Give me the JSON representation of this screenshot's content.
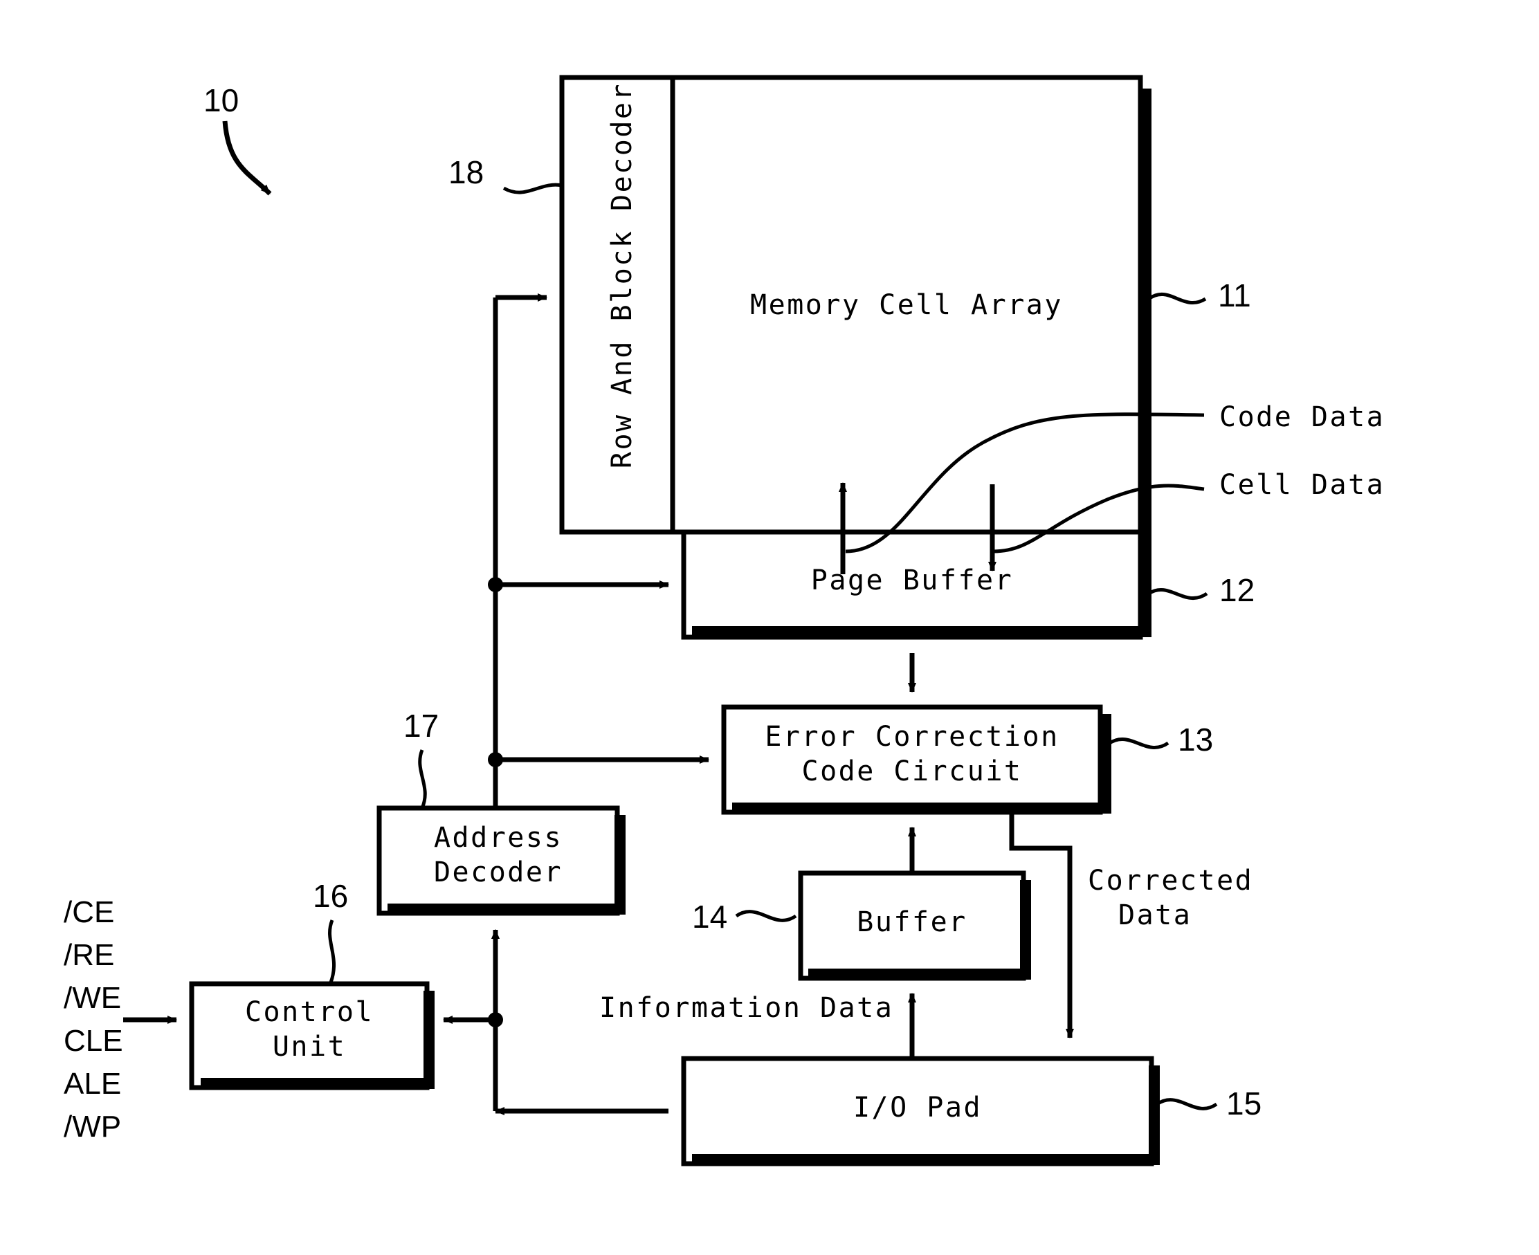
{
  "figure": {
    "type": "block-diagram",
    "title_ref": "10",
    "blocks": [
      {
        "id": "row_block_decoder",
        "label": "Row And Block Decoder",
        "ref": "18",
        "orientation": "vertical"
      },
      {
        "id": "memory_cell_array",
        "label": "Memory Cell Array",
        "ref": "11",
        "orientation": "horizontal"
      },
      {
        "id": "page_buffer",
        "label": "Page Buffer",
        "ref": "12",
        "orientation": "horizontal"
      },
      {
        "id": "ecc_circuit",
        "label": "Error Correction\nCode Circuit",
        "line1": "Error Correction",
        "line2": "Code Circuit",
        "ref": "13",
        "orientation": "horizontal"
      },
      {
        "id": "address_decoder",
        "label": "Address\nDecoder",
        "line1": "Address",
        "line2": "Decoder",
        "ref": "17",
        "orientation": "horizontal"
      },
      {
        "id": "control_unit",
        "label": "Control\nUnit",
        "line1": "Control",
        "line2": "Unit",
        "ref": "16",
        "orientation": "horizontal"
      },
      {
        "id": "buffer",
        "label": "Buffer",
        "ref": "14",
        "orientation": "horizontal"
      },
      {
        "id": "io_pad",
        "label": "I/O Pad",
        "ref": "15",
        "orientation": "horizontal"
      }
    ],
    "flow_labels": [
      {
        "id": "code_data",
        "text": "Code Data"
      },
      {
        "id": "cell_data",
        "text": "Cell Data"
      },
      {
        "id": "corrected_data",
        "line1": "Corrected",
        "line2": "Data"
      },
      {
        "id": "information_data",
        "text": "Information Data"
      }
    ],
    "input_signals": [
      "/CE",
      "/RE",
      "/WE",
      "CLE",
      "ALE",
      "/WP"
    ],
    "reference_numerals": [
      "10",
      "11",
      "12",
      "13",
      "14",
      "15",
      "16",
      "17",
      "18"
    ],
    "colors": {
      "stroke": "#000000",
      "background": "#ffffff",
      "shadow": "#000000"
    }
  }
}
